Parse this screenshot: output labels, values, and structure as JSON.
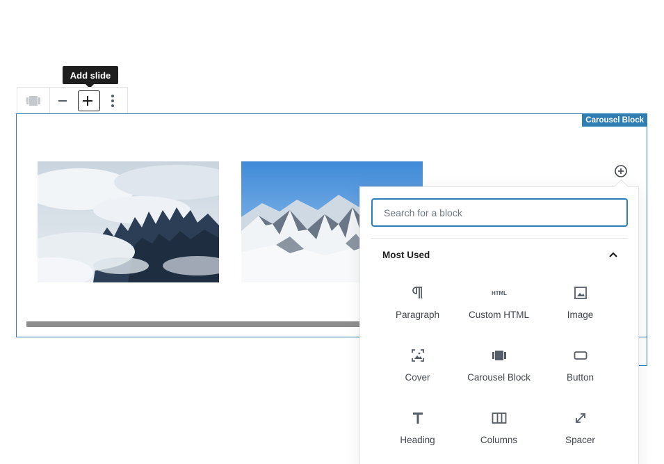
{
  "tooltip": {
    "text": "Add slide"
  },
  "toolbar": {
    "buttons": [
      {
        "name": "carousel-block-type",
        "icon": "carousel-icon"
      },
      {
        "name": "remove-slide",
        "icon": "minus-icon"
      },
      {
        "name": "add-slide",
        "icon": "plus-icon",
        "active": true
      },
      {
        "name": "more-options",
        "icon": "more-vertical-icon"
      }
    ]
  },
  "carousel": {
    "label": "Carousel Block",
    "slides": [
      {
        "description": "foggy forest"
      },
      {
        "description": "snowy mountains"
      }
    ],
    "add_button_icon": "plus-circle-icon"
  },
  "inserter": {
    "search_placeholder": "Search for a block",
    "section_title": "Most Used",
    "collapse_icon": "chevron-up-icon",
    "items": [
      {
        "label": "Paragraph",
        "icon": "paragraph-icon"
      },
      {
        "label": "Custom HTML",
        "icon": "html-icon"
      },
      {
        "label": "Image",
        "icon": "image-icon"
      },
      {
        "label": "Cover",
        "icon": "cover-icon"
      },
      {
        "label": "Carousel Block",
        "icon": "carousel-icon"
      },
      {
        "label": "Button",
        "icon": "button-icon"
      },
      {
        "label": "Heading",
        "icon": "heading-icon"
      },
      {
        "label": "Columns",
        "icon": "columns-icon"
      },
      {
        "label": "Spacer",
        "icon": "spacer-icon"
      }
    ]
  },
  "colors": {
    "accent": "#2e7db3",
    "dark": "#1e1e1e",
    "icon": "#555d66"
  }
}
